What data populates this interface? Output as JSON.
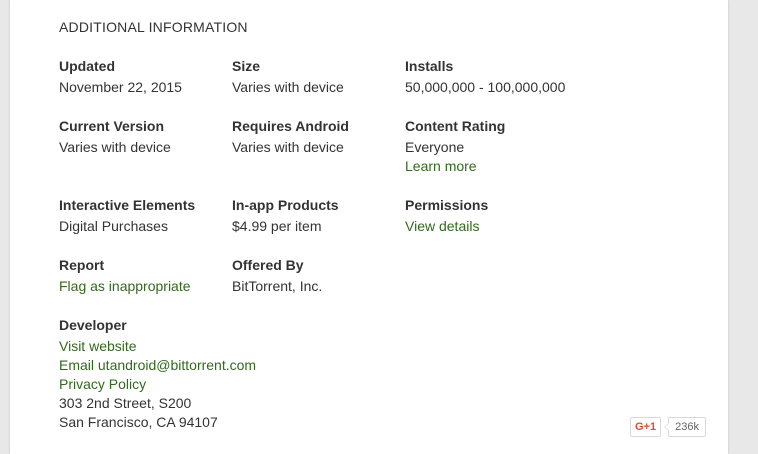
{
  "section_title": "ADDITIONAL INFORMATION",
  "colors": {
    "link": "#33691e",
    "text": "#333333",
    "gplus": "#dd4b39"
  },
  "updated": {
    "label": "Updated",
    "value": "November 22, 2015"
  },
  "size": {
    "label": "Size",
    "value": "Varies with device"
  },
  "installs": {
    "label": "Installs",
    "value": "50,000,000 - 100,000,000"
  },
  "current_version": {
    "label": "Current Version",
    "value": "Varies with device"
  },
  "requires_android": {
    "label": "Requires Android",
    "value": "Varies with device"
  },
  "content_rating": {
    "label": "Content Rating",
    "value": "Everyone",
    "link": "Learn more"
  },
  "interactive_elements": {
    "label": "Interactive Elements",
    "value": "Digital Purchases"
  },
  "in_app_products": {
    "label": "In-app Products",
    "value": "$4.99 per item"
  },
  "permissions": {
    "label": "Permissions",
    "link": "View details"
  },
  "report": {
    "label": "Report",
    "link": "Flag as inappropriate"
  },
  "offered_by": {
    "label": "Offered By",
    "value": "BitTorrent, Inc."
  },
  "developer": {
    "label": "Developer",
    "visit_website": "Visit website",
    "email": "Email utandroid@bittorrent.com",
    "privacy_policy": "Privacy Policy",
    "address_line1": "303 2nd Street, S200",
    "address_line2": "San Francisco, CA 94107"
  },
  "gplus": {
    "button_label": "G+1",
    "count": "236k",
    "icon": "google-plus-icon"
  }
}
